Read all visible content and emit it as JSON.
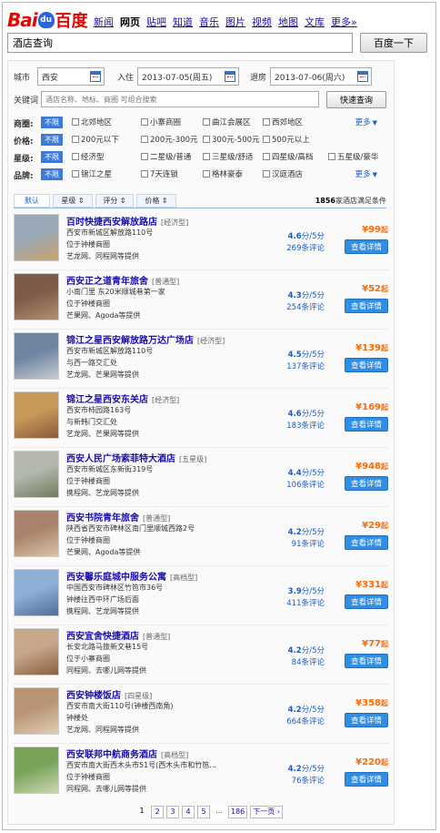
{
  "brand": {
    "logo_left": "Bai",
    "logo_paw": "du",
    "logo_right": "百度"
  },
  "nav": [
    "新闻",
    "网页",
    "贴吧",
    "知道",
    "音乐",
    "图片",
    "视频",
    "地图",
    "文库",
    "更多»"
  ],
  "nav_active_index": 1,
  "search": {
    "value": "酒店查询",
    "button": "百度一下"
  },
  "panel": {
    "city_label": "城市",
    "city_value": "西安",
    "checkin_label": "入住",
    "checkin_value": "2013-07-05(周五)",
    "checkout_label": "退房",
    "checkout_value": "2013-07-06(周六)",
    "keyword_label": "关键词",
    "keyword_placeholder": "酒店名称、地标、商圈 可组合搜索",
    "quick_button": "快速查询"
  },
  "filters": [
    {
      "label": "商圈:",
      "unlimited": "不限",
      "options": [
        "北郊地区",
        "小寨商圈",
        "曲江会展区",
        "西郊地区"
      ],
      "more": "更多"
    },
    {
      "label": "价格:",
      "unlimited": "不限",
      "options": [
        "200元以下",
        "200元-300元",
        "300元-500元",
        "500元以上"
      ],
      "more": ""
    },
    {
      "label": "星级:",
      "unlimited": "不限",
      "options": [
        "经济型",
        "二星级/普通",
        "三星级/舒适",
        "四星级/高档",
        "五星级/豪华"
      ],
      "more": ""
    },
    {
      "label": "品牌:",
      "unlimited": "不限",
      "options": [
        "锦江之星",
        "7天连锁",
        "格林豪泰",
        "汉庭酒店"
      ],
      "more": "更多"
    }
  ],
  "sort": {
    "tabs": [
      "默认",
      "星级 ⇕",
      "评分 ⇕",
      "价格 ⇕"
    ],
    "count_num": "1856",
    "count_text": "家酒店满足条件"
  },
  "hotels": [
    {
      "name": "百时快捷西安解放路店",
      "grade": "[经济型]",
      "addr": "西安市新城区解放路110号",
      "area": "位于钟楼商圈",
      "src": "艺龙网、同程网等提供",
      "score": "4.6",
      "score_unit": "分/5分",
      "reviews": "269条评论",
      "price": "¥99",
      "qi": "起",
      "btn": "查看详情",
      "photo": [
        "#9aa9b8",
        "#c9a26b"
      ]
    },
    {
      "name": "西安正之道青年旅舍",
      "grade": "[普通型]",
      "addr": "小南门里 东20米顺城巷第一家",
      "area": "位于钟楼商圈",
      "src": "芒果网、Agoda等提供",
      "score": "4.3",
      "score_unit": "分/5分",
      "reviews": "254条评论",
      "price": "¥52",
      "qi": "起",
      "btn": "查看详情",
      "photo": [
        "#7d5a4a",
        "#b09070"
      ]
    },
    {
      "name": "锦江之星西安解放路万达广场店",
      "grade": "[经济型]",
      "addr": "西安市新城区解放路110号",
      "area": "与西一路交汇处",
      "src": "艺龙网、芒果网等提供",
      "score": "4.5",
      "score_unit": "分/5分",
      "reviews": "137条评论",
      "price": "¥139",
      "qi": "起",
      "btn": "查看详情",
      "photo": [
        "#6f84a0",
        "#c7ccd4"
      ]
    },
    {
      "name": "锦江之星西安东关店",
      "grade": "[经济型]",
      "addr": "西安市柿园路163号",
      "area": "与新韩门交汇处",
      "src": "艺龙网、芒果网等提供",
      "score": "4.6",
      "score_unit": "分/5分",
      "reviews": "183条评论",
      "price": "¥169",
      "qi": "起",
      "btn": "查看详情",
      "photo": [
        "#c89a5a",
        "#8a5a3a"
      ]
    },
    {
      "name": "西安人民广场索菲特大酒店",
      "grade": "[五星级]",
      "addr": "西安市新城区东新街319号",
      "area": "位于钟楼商圈",
      "src": "携程网、艺龙网等提供",
      "score": "4.4",
      "score_unit": "分/5分",
      "reviews": "106条评论",
      "price": "¥948",
      "qi": "起",
      "btn": "查看详情",
      "photo": [
        "#b3b7ad",
        "#6f7c5e"
      ]
    },
    {
      "name": "西安书院青年旅舍",
      "grade": "[普通型]",
      "addr": "陕西省西安市碑林区南门里顺城西路2号",
      "area": "位于钟楼商圈",
      "src": "芒果网、Agoda等提供",
      "score": "4.2",
      "score_unit": "分/5分",
      "reviews": "91条评论",
      "price": "¥29",
      "qi": "起",
      "btn": "查看详情",
      "photo": [
        "#a8826a",
        "#d9c3a7"
      ]
    },
    {
      "name": "西安馨乐庭城中服务公寓",
      "grade": "[高档型]",
      "addr": "中国西安市碑林区竹笆市36号",
      "area": "钟楼往西中环广场后面",
      "src": "携程网、艺龙网等提供",
      "score": "3.9",
      "score_unit": "分/5分",
      "reviews": "411条评论",
      "price": "¥331",
      "qi": "起",
      "btn": "查看详情",
      "photo": [
        "#8fb0d6",
        "#4f6e9a"
      ]
    },
    {
      "name": "西安宜舍快捷酒店",
      "grade": "[普通型]",
      "addr": "长安北路马旅新文巷15号",
      "area": "位于小寨商圈",
      "src": "同程网、去哪儿网等提供",
      "score": "4.2",
      "score_unit": "分/5分",
      "reviews": "84条评论",
      "price": "¥77",
      "qi": "起",
      "btn": "查看详情",
      "photo": [
        "#c6a78a",
        "#8c5f44"
      ]
    },
    {
      "name": "西安钟楼饭店",
      "grade": "[四星级]",
      "addr": "西安市南大街110号(钟楼西南角)",
      "area": "钟楼处",
      "src": "艺龙网、同程网等提供",
      "score": "4.2",
      "score_unit": "分/5分",
      "reviews": "664条评论",
      "price": "¥358",
      "qi": "起",
      "btn": "查看详情",
      "photo": [
        "#b89474",
        "#e0cdb5"
      ]
    },
    {
      "name": "西安联邦中航商务酒店",
      "grade": "[高档型]",
      "addr": "西安市南大街西木头市51号(西木头市和竹笆...",
      "area": "位于钟楼商圈",
      "src": "同程网、去哪儿网等提供",
      "score": "4.2",
      "score_unit": "分/5分",
      "reviews": "76条评论",
      "price": "¥220",
      "qi": "起",
      "btn": "查看详情",
      "photo": [
        "#7aa35a",
        "#c9d8b0"
      ]
    }
  ],
  "pager": [
    "1",
    "2",
    "3",
    "4",
    "5",
    "...",
    "186",
    "下一页 ›"
  ]
}
